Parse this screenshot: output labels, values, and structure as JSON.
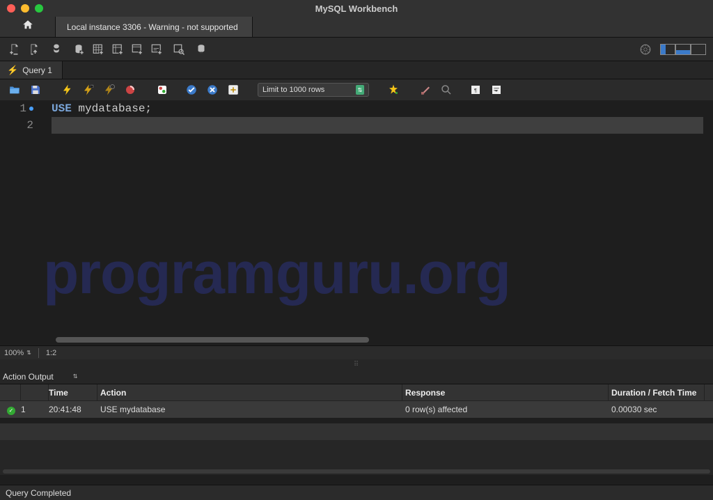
{
  "window": {
    "title": "MySQL Workbench"
  },
  "conn_tab": {
    "label": "Local instance 3306 - Warning - not supported"
  },
  "query_tab": {
    "label": "Query 1"
  },
  "query_toolbar": {
    "limit_label": "Limit to 1000 rows"
  },
  "editor": {
    "line1_keyword": "USE",
    "line1_rest": " mydatabase;",
    "gutter": [
      "1",
      "2"
    ],
    "watermark": "programguru.org"
  },
  "editor_status": {
    "zoom": "100%",
    "pos": "1:2"
  },
  "output": {
    "panel_label": "Action Output",
    "columns": {
      "time": "Time",
      "action": "Action",
      "response": "Response",
      "duration": "Duration / Fetch Time"
    },
    "rows": [
      {
        "num": "1",
        "time": "20:41:48",
        "action": "USE mydatabase",
        "response": "0 row(s) affected",
        "duration": "0.00030 sec"
      }
    ]
  },
  "status_bar": {
    "text": "Query Completed"
  }
}
